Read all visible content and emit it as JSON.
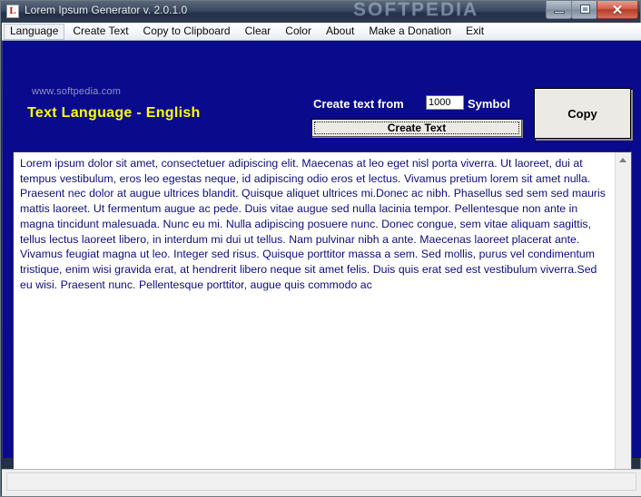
{
  "window": {
    "title": "Lorem Ipsum Generator  v. 2.0.1.0",
    "icon_letter": "L",
    "watermark": "SOFTPEDIA",
    "controls": {
      "minimize": "minimize",
      "maximize": "maximize",
      "close": "✕"
    }
  },
  "menubar": {
    "items": [
      {
        "label": "Language",
        "highlighted": true
      },
      {
        "label": "Create Text",
        "highlighted": false
      },
      {
        "label": "Copy to Clipboard",
        "highlighted": false
      },
      {
        "label": "Clear",
        "highlighted": false
      },
      {
        "label": "Color",
        "highlighted": false
      },
      {
        "label": "About",
        "highlighted": false
      },
      {
        "label": "Make a Donation",
        "highlighted": false
      },
      {
        "label": "Exit",
        "highlighted": false
      }
    ]
  },
  "panel": {
    "site_watermark": "www.softpedia.com",
    "language_label": "Text Language - English",
    "create_from_label": "Create text from",
    "symbol_label": "Symbol",
    "count_value": "1000",
    "count_placeholder": "1000",
    "create_button": "Create Text",
    "copy_button": "Copy",
    "colors": {
      "background": "#0a0a8c",
      "accent_yellow": "#ffff00",
      "label_white": "#ffffff",
      "text_blue": "#0d0d7d"
    }
  },
  "textarea": {
    "content": "Lorem ipsum dolor sit amet, consectetuer adipiscing elit. Maecenas at leo eget nisl porta viverra. Ut laoreet, dui at tempus vestibulum, eros leo egestas neque, id adipiscing odio eros et lectus. Vivamus pretium lorem sit amet nulla. Praesent nec dolor at augue ultrices blandit. Quisque aliquet ultrices mi.Donec ac nibh. Phasellus sed sem sed mauris mattis laoreet. Ut fermentum augue ac pede. Duis vitae augue sed nulla lacinia tempor. Pellentesque non ante in magna tincidunt malesuada. Nunc eu mi. Nulla adipiscing posuere nunc. Donec congue, sem vitae aliquam sagittis, tellus lectus laoreet libero, in interdum mi dui ut tellus. Nam pulvinar nibh a ante. Maecenas laoreet placerat ante. Vivamus feugiat magna ut leo. Integer sed risus. Quisque porttitor massa a sem. Sed mollis, purus vel condimentum tristique, enim wisi gravida erat, at hendrerit libero neque sit amet felis. Duis quis erat sed est vestibulum viverra.Sed eu wisi. Praesent nunc. Pellentesque porttitor, augue quis commodo ac"
  }
}
